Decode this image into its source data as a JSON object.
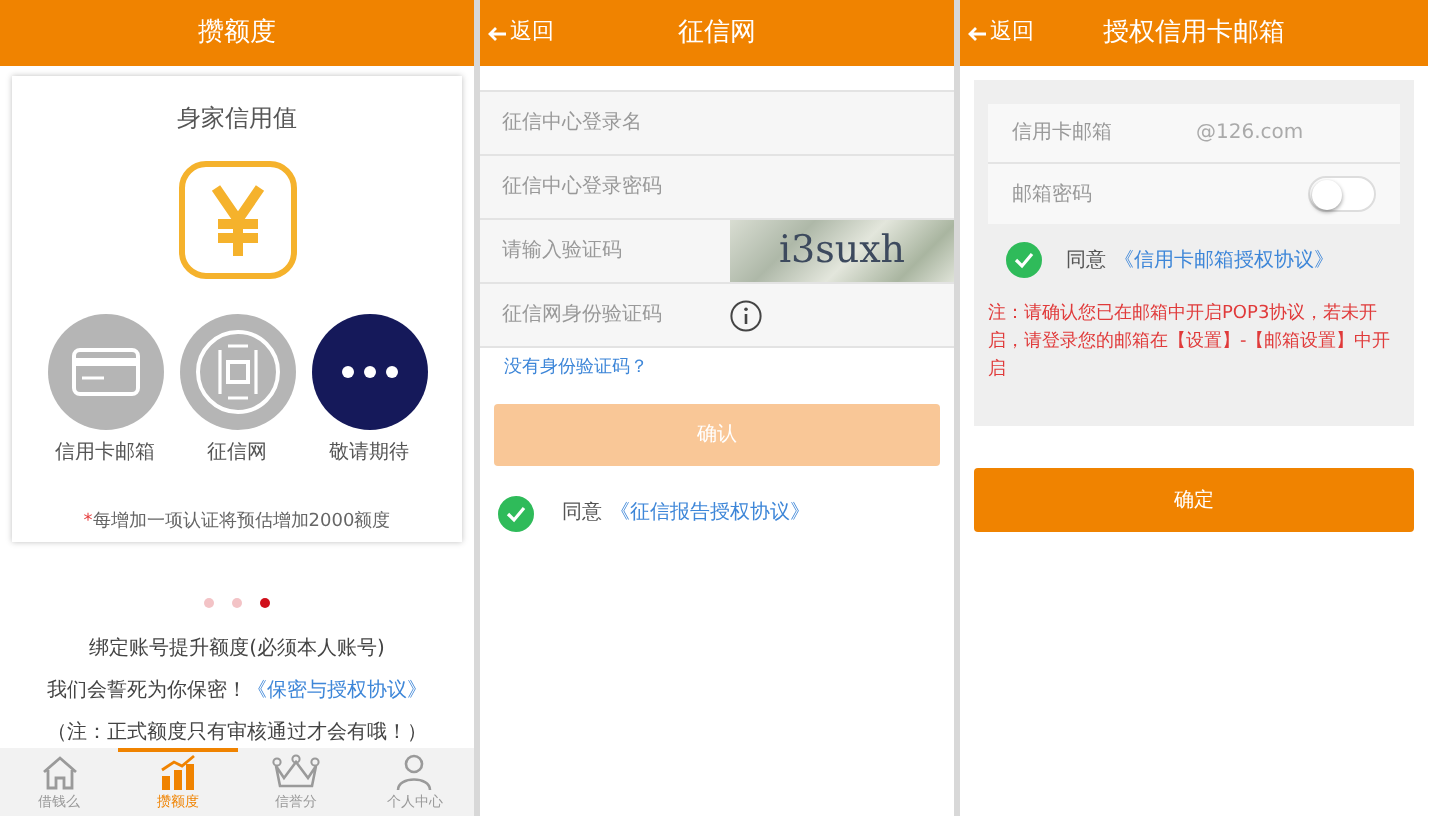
{
  "credit_screen": {
    "title": "攒额度",
    "card": {
      "heading": "身家信用值",
      "sources": [
        {
          "kind": "card",
          "label": "信用卡邮箱"
        },
        {
          "kind": "seal",
          "label": "征信网"
        },
        {
          "kind": "more",
          "label": "敬请期待"
        }
      ],
      "note_mark": "*",
      "note": "每增加一项认证将预估增加2000额度"
    },
    "dots": [
      {
        "selected": false
      },
      {
        "selected": false
      },
      {
        "selected": true
      }
    ],
    "bind_text": "绑定账号提升额度(必须本人账号)",
    "privacy_text": "我们会誓死为你保密！",
    "privacy_link": "《保密与授权协议》",
    "notice": "（注：正式额度只有审核通过才会有哦！）",
    "nav": [
      {
        "kind": "home",
        "label": "借钱么",
        "selected": false
      },
      {
        "kind": "chart",
        "label": "攒额度",
        "selected": true
      },
      {
        "kind": "crown",
        "label": "信誉分",
        "selected": false
      },
      {
        "kind": "person",
        "label": "个人中心",
        "selected": false
      }
    ]
  },
  "credit_report_screen": {
    "back": "返回",
    "title": "征信网",
    "fields": [
      {
        "kind": "text",
        "placeholder": "征信中心登录名"
      },
      {
        "kind": "text",
        "placeholder": "征信中心登录密码"
      },
      {
        "kind": "captcha",
        "placeholder": "请输入验证码",
        "captcha_text": "i3suxh"
      },
      {
        "kind": "info",
        "placeholder": "征信网身份验证码"
      }
    ],
    "help_link": "没有身份验证码？",
    "confirm": {
      "label": "确认",
      "disabled": true
    },
    "agree": {
      "checked": true,
      "label": "同意",
      "link": "《征信报告授权协议》"
    }
  },
  "email_screen": {
    "back": "返回",
    "title": "授权信用卡邮箱",
    "email": {
      "label": "信用卡邮箱",
      "placeholder": "@126.com"
    },
    "password": {
      "label": "邮箱密码",
      "on": false
    },
    "agree": {
      "checked": true,
      "label": "同意",
      "link": "《信用卡邮箱授权协议》"
    },
    "warning": "注：请确认您已在邮箱中开启POP3协议，若未开启，请登录您的邮箱在【设置】-【邮箱设置】中开启",
    "confirm": {
      "label": "确定",
      "disabled": false
    }
  }
}
